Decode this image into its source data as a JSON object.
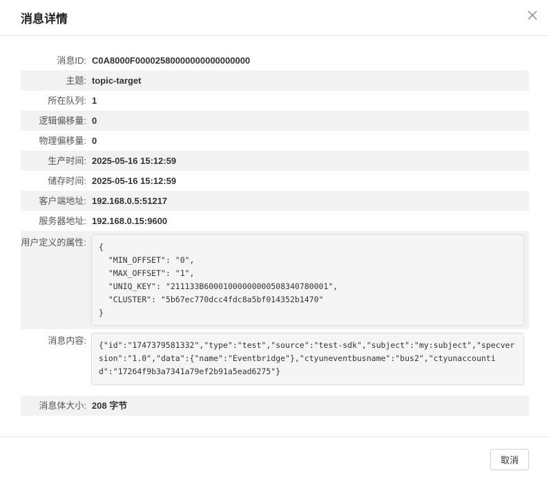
{
  "dialog": {
    "title": "消息详情",
    "close_icon": "close-icon"
  },
  "fields": {
    "msg_id": {
      "label": "消息ID:",
      "value": "C0A8000F00002580000000000000000"
    },
    "topic": {
      "label": "主题:",
      "value": "topic-target"
    },
    "queue": {
      "label": "所在队列:",
      "value": "1"
    },
    "logical_offset": {
      "label": "逻辑偏移量:",
      "value": "0"
    },
    "physical_offset": {
      "label": "物理偏移量:",
      "value": "0"
    },
    "produce_time": {
      "label": "生产时间:",
      "value": "2025-05-16 15:12:59"
    },
    "store_time": {
      "label": "储存时间:",
      "value": "2025-05-16 15:12:59"
    },
    "client_addr": {
      "label": "客户端地址:",
      "value": "192.168.0.5:51217"
    },
    "server_addr": {
      "label": "服务器地址:",
      "value": "192.168.0.15:9600"
    },
    "user_props": {
      "label": "用户定义的属性:",
      "value": "{\n  \"MIN_OFFSET\": \"0\",\n  \"MAX_OFFSET\": \"1\",\n  \"UNIQ_KEY\": \"211133B60001000000000508340780001\",\n  \"CLUSTER\": \"5b67ec770dcc4fdc8a5bf014352b1470\"\n}"
    },
    "content": {
      "label": "消息内容:",
      "value": "{\"id\":\"1747379581332\",\"type\":\"test\",\"source\":\"test-sdk\",\"subject\":\"my:subject\",\"specversion\":\"1.0\",\"data\":{\"name\":\"Eventbridge\"},\"ctyuneventbusname\":\"bus2\",\"ctyunaccountid\":\"17264f9b3a7341a79ef2b91a5ead6275\"}"
    },
    "body_size": {
      "label": "消息体大小:",
      "value": "208 字节"
    }
  },
  "footer": {
    "cancel_label": "取消"
  }
}
